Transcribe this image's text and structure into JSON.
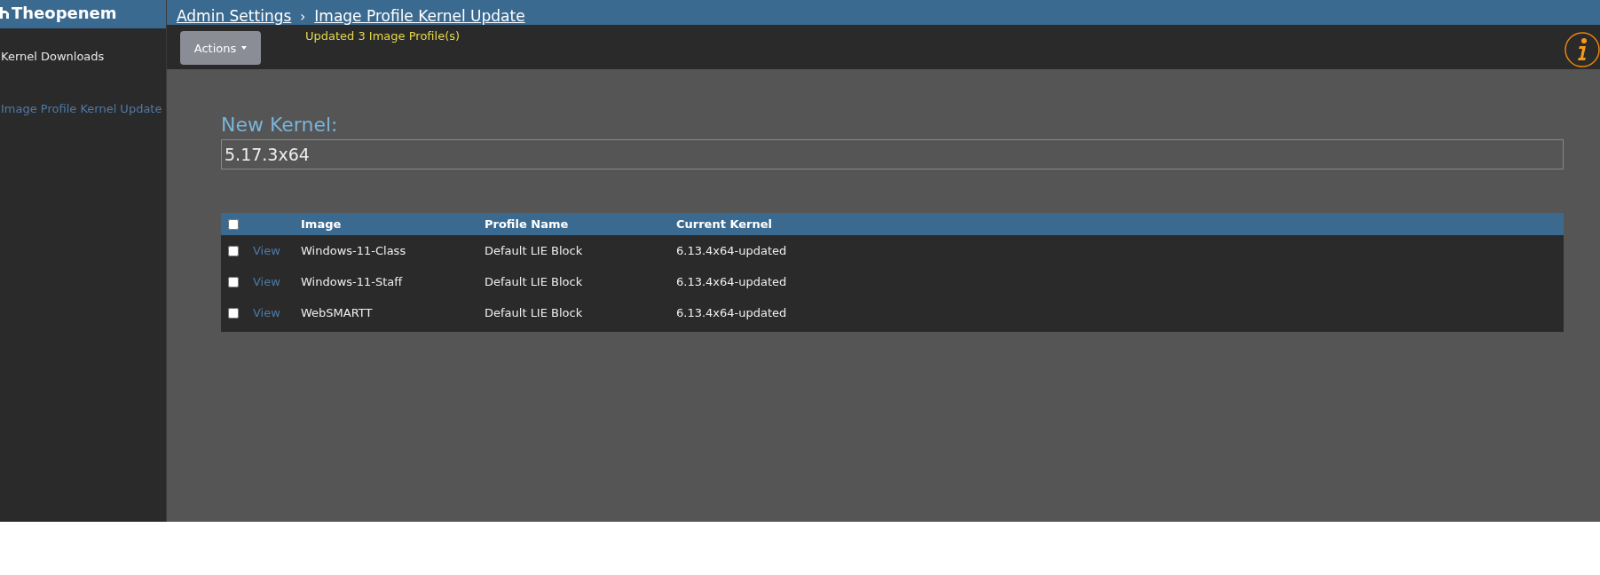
{
  "brand": {
    "name": "Theopenem"
  },
  "breadcrumb": [
    {
      "label": "Admin Settings"
    },
    {
      "label": "Image Profile Kernel Update"
    }
  ],
  "breadcrumb_separator": "›",
  "sidebar": {
    "items": [
      {
        "label": "Kernel Downloads",
        "selected": false
      },
      {
        "label": "Image Profile Kernel Update",
        "selected": true
      }
    ]
  },
  "toolbar": {
    "actions_button": "Actions",
    "status_message": "Updated 3 Image Profile(s)"
  },
  "form": {
    "label": "New Kernel:",
    "value": "5.17.3x64"
  },
  "table": {
    "select_all_checked": false,
    "columns": [
      "Image",
      "Profile Name",
      "Current Kernel"
    ],
    "rows": [
      {
        "checked": false,
        "link": "View",
        "image": "Windows-11-Class",
        "profile": "Default LIE Block",
        "kernel": "6.13.4x64-updated"
      },
      {
        "checked": false,
        "link": "View",
        "image": "Windows-11-Staff",
        "profile": "Default LIE Block",
        "kernel": "6.13.4x64-updated"
      },
      {
        "checked": false,
        "link": "View",
        "image": "WebSMARTT",
        "profile": "Default LIE Block",
        "kernel": "6.13.4x64-updated"
      }
    ]
  }
}
